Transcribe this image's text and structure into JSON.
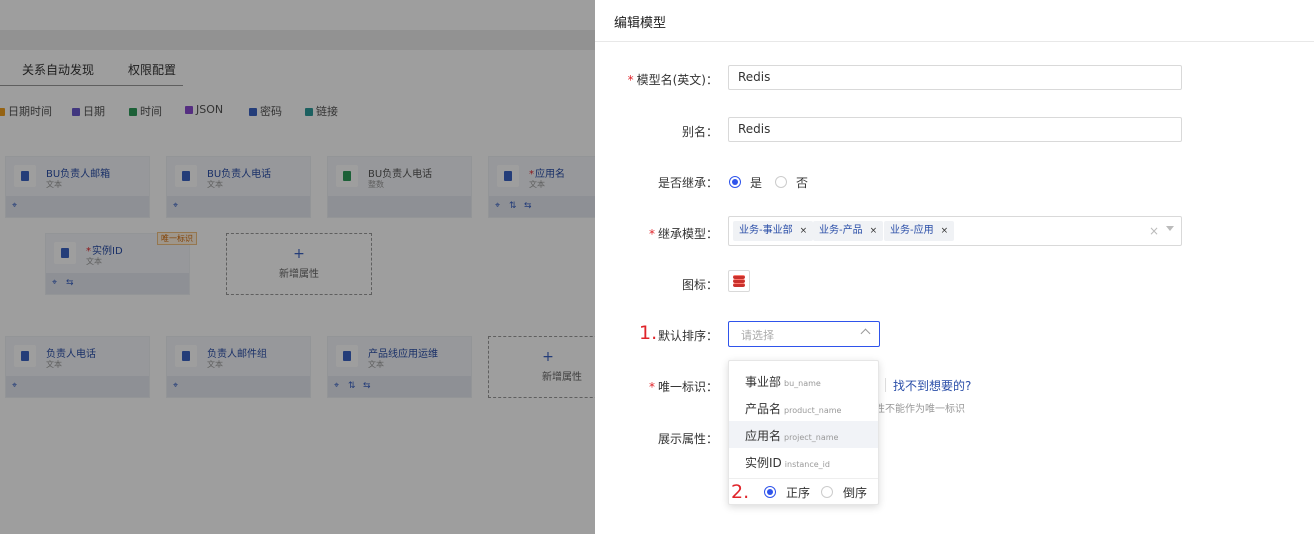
{
  "background": {
    "tabs": [
      "关系自动发现",
      "权限配置"
    ],
    "type_toolbar": [
      {
        "label": "日期时间",
        "icon": "clock-icon",
        "color": "#f0a020"
      },
      {
        "label": "日期",
        "icon": "calendar-icon",
        "color": "#6a5acd"
      },
      {
        "label": "时间",
        "icon": "hourglass-icon",
        "color": "#2e9c5a"
      },
      {
        "label": "JSON",
        "icon": "json-icon",
        "color": "#8a4bd0"
      },
      {
        "label": "密码",
        "icon": "lock-icon",
        "color": "#3b63c4"
      },
      {
        "label": "链接",
        "icon": "link-icon",
        "color": "#2e9c9c"
      }
    ],
    "cards_row1": [
      {
        "name": "BU负责人邮箱",
        "type": "文本"
      },
      {
        "name": "BU负责人电话",
        "type": "文本"
      },
      {
        "name": "BU负责人电话",
        "type": "整数"
      },
      {
        "name": "应用名",
        "type": "文本"
      }
    ],
    "card_instance": {
      "name": "实例ID",
      "type": "文本",
      "badge": "唯一标识"
    },
    "cards_row3": [
      {
        "name": "负责人电话",
        "type": "文本"
      },
      {
        "name": "负责人邮件组",
        "type": "文本"
      },
      {
        "name": "产品线应用运维",
        "type": "文本"
      }
    ],
    "add_label": "新增属性",
    "add_symbol": "+"
  },
  "drawer": {
    "title": "编辑模型",
    "model_name": {
      "label": "模型名(英文)：",
      "value": "Redis"
    },
    "alias": {
      "label": "别名：",
      "value": "Redis"
    },
    "inherit": {
      "label": "是否继承：",
      "yes": "是",
      "no": "否"
    },
    "inherit_model": {
      "label": "继承模型：",
      "tags": [
        "业务-事业部",
        "业务-产品",
        "业务-应用"
      ]
    },
    "icon": {
      "label": "图标："
    },
    "default_sort": {
      "label": "默认排序：",
      "placeholder": "请选择",
      "step": "1."
    },
    "unique": {
      "label": "唯一标识：",
      "link": "找不到想要的?",
      "hint": "性不能作为唯一标识"
    },
    "display": {
      "label": "展示属性："
    },
    "sort_options": [
      {
        "label": "事业部",
        "key": "bu_name"
      },
      {
        "label": "产品名",
        "key": "product_name"
      },
      {
        "label": "应用名",
        "key": "project_name"
      },
      {
        "label": "实例ID",
        "key": "instance_id"
      }
    ],
    "order": {
      "step": "2.",
      "asc": "正序",
      "desc": "倒序"
    },
    "required_mark": "*",
    "clear_symbol": "×",
    "tag_close": "×"
  }
}
